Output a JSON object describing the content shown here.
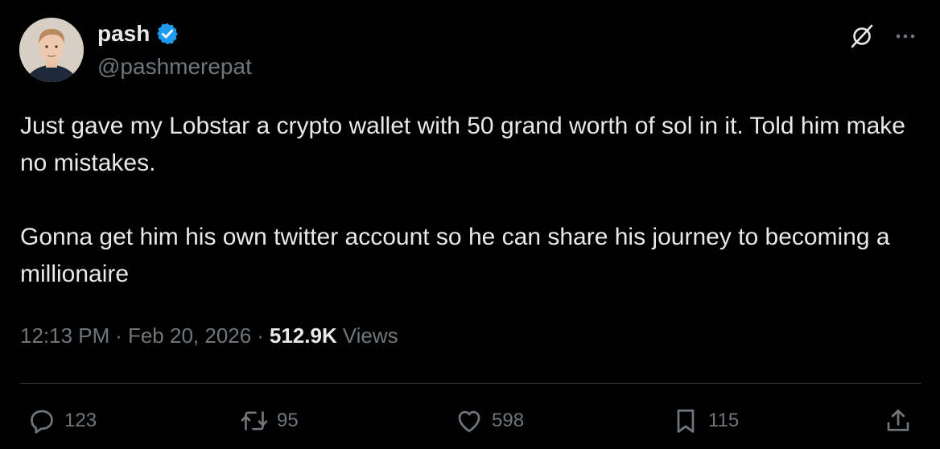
{
  "user": {
    "display_name": "pash",
    "handle": "@pashmerepat",
    "verified": true,
    "verified_color": "#1d9bf0"
  },
  "header_icons": [
    "grok-icon",
    "more-icon"
  ],
  "tweet": {
    "paragraphs": [
      "Just gave my Lobstar a crypto wallet with 50 grand worth of sol in it. Told him make no mistakes.",
      "Gonna get him his own twitter account so he can share his journey to becoming a millionaire"
    ],
    "time": "12:13 PM",
    "date": "Feb 20, 2026",
    "views_count": "512.9K",
    "views_label": "Views"
  },
  "actions": {
    "reply": {
      "icon": "reply-icon",
      "count": "123"
    },
    "retweet": {
      "icon": "retweet-icon",
      "count": "95"
    },
    "like": {
      "icon": "like-icon",
      "count": "598"
    },
    "bookmark": {
      "icon": "bookmark-icon",
      "count": "115"
    },
    "share": {
      "icon": "share-icon"
    }
  },
  "colors": {
    "background": "#000000",
    "text_primary": "#e7e9ea",
    "text_secondary": "#71767b",
    "divider": "#2f3336"
  }
}
